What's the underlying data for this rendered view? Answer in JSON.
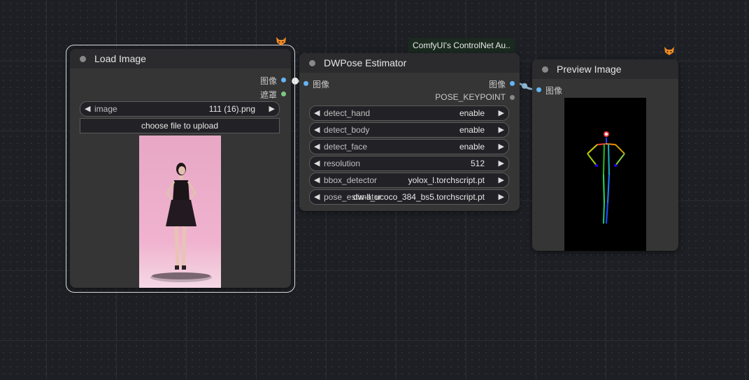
{
  "nodes": {
    "load_image": {
      "title": "Load Image",
      "outputs": [
        "图像",
        "遮罩"
      ],
      "image_widget": {
        "name": "image",
        "value": "111 (16).png"
      },
      "upload_button": "choose file to upload"
    },
    "dwpose": {
      "badge": "ComfyUI's ControlNet Au..",
      "title": "DWPose Estimator",
      "input": "图像",
      "outputs": [
        "图像",
        "POSE_KEYPOINT"
      ],
      "widgets": [
        {
          "name": "detect_hand",
          "value": "enable"
        },
        {
          "name": "detect_body",
          "value": "enable"
        },
        {
          "name": "detect_face",
          "value": "enable"
        },
        {
          "name": "resolution",
          "value": "512"
        },
        {
          "name": "bbox_detector",
          "value": "yolox_l.torchscript.pt"
        },
        {
          "name": "pose_estimator",
          "value": "dw-ll_ucoco_384_bs5.torchscript.pt"
        }
      ]
    },
    "preview": {
      "title": "Preview Image",
      "input": "图像"
    }
  },
  "colors": {
    "image_slot": "#64b5f6",
    "mask_slot": "#81c784",
    "keypoint_slot": "#888888",
    "link": "#8fb9d4"
  },
  "icons": [
    "fox-badge-icon"
  ]
}
